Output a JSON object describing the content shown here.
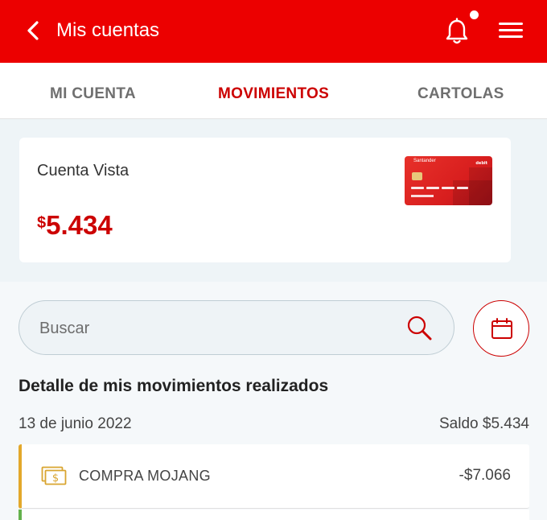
{
  "header": {
    "title": "Mis cuentas",
    "back_icon": "chevron-left-icon",
    "notification_icon": "bell-icon",
    "menu_icon": "hamburger-menu-icon",
    "brand_color": "#ec0000"
  },
  "tabs": [
    {
      "label": "MI CUENTA",
      "active": false
    },
    {
      "label": "MOVIMIENTOS",
      "active": true
    },
    {
      "label": "CARTOLAS",
      "active": false
    }
  ],
  "account": {
    "name": "Cuenta Vista",
    "currency_symbol": "$",
    "balance": "5.434",
    "card_brand": "Santander",
    "card_type": "debit"
  },
  "search": {
    "placeholder": "Buscar",
    "search_icon": "magnifier-icon",
    "calendar_icon": "calendar-icon"
  },
  "movements": {
    "section_title": "Detalle de mis movimientos realizados",
    "date": "13 de junio 2022",
    "saldo": "Saldo $5.434",
    "items": [
      {
        "name": "COMPRA MOJANG",
        "amount": "-$7.066",
        "icon": "money-bill-icon",
        "accent": "#e3a82b"
      }
    ],
    "next_accent": "#63b14c"
  }
}
